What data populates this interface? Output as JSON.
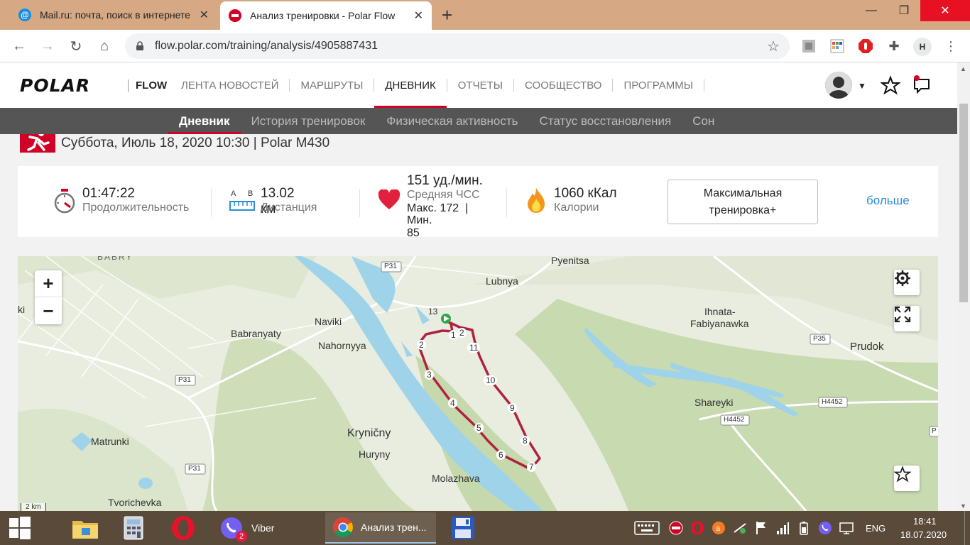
{
  "browser": {
    "tabs": [
      {
        "title": "Mail.ru: почта, поиск в интернете",
        "active": false
      },
      {
        "title": "Анализ тренировки - Polar Flow",
        "active": true
      }
    ],
    "url": "flow.polar.com/training/analysis/4905887431",
    "profile_initial": "H"
  },
  "header": {
    "logo": "POLAR",
    "product": "FLOW",
    "nav": [
      "ЛЕНТА НОВОСТЕЙ",
      "МАРШРУТЫ",
      "ДНЕВНИК",
      "ОТЧЕТЫ",
      "СООБЩЕСТВО",
      "ПРОГРАММЫ"
    ],
    "active_nav": "ДНЕВНИК"
  },
  "subnav": {
    "items": [
      "Дневник",
      "История тренировок",
      "Физическая активность",
      "Статус восстановления",
      "Сон"
    ],
    "active": "Дневник"
  },
  "session": {
    "title": "Суббота, Июль 18, 2020 10:30 | Polar M430"
  },
  "summary": {
    "duration": {
      "value": "01:47:22",
      "label": "Продолжительность"
    },
    "distance": {
      "value": "13.02 км",
      "label": "Дистанция",
      "icon_a": "A",
      "icon_b": "B"
    },
    "heart_rate": {
      "value": "151 уд./мин.",
      "label": "Средняя ЧСС",
      "max": "Макс. 172  |",
      "min": "Мин. 85"
    },
    "calories": {
      "value": "1060 кКал",
      "label": "Калории"
    },
    "benefit_button": "Максимальная тренировка+",
    "more": "больше"
  },
  "map": {
    "places": [
      {
        "name": "BABRY"
      },
      {
        "name": "Pyenitsa"
      },
      {
        "name": "Lubnya"
      },
      {
        "name": "Naviki"
      },
      {
        "name": "Babranyaty"
      },
      {
        "name": "Nahornyya"
      },
      {
        "name": "Ihnata-"
      },
      {
        "name": "Fabiyanawka"
      },
      {
        "name": "Prudok"
      },
      {
        "name": "Shareyki"
      },
      {
        "name": "Kryničny"
      },
      {
        "name": "Huryny"
      },
      {
        "name": "Matrunki"
      },
      {
        "name": "Molazhava"
      },
      {
        "name": "Tvorichevka"
      },
      {
        "name": "ki"
      }
    ],
    "road_labels": [
      "P31",
      "P31",
      "P31",
      "P35",
      "H4452",
      "H4452",
      "P"
    ],
    "km_markers": [
      "13",
      "1",
      "2",
      "2",
      "11",
      "3",
      "10",
      "4",
      "9",
      "5",
      "8",
      "6",
      "7"
    ],
    "scale": "2 km",
    "zoom_in": "+",
    "zoom_out": "−"
  },
  "taskbar": {
    "viber_label": "Viber",
    "viber_badge": "2",
    "chrome_label": "Анализ трен...",
    "lang": "ENG",
    "time": "18:41",
    "date": "18.07.2020"
  },
  "colors": {
    "polar_red": "#d10027",
    "route": "#b0223f",
    "water": "#9fd3ea",
    "link": "#2a8fd6"
  }
}
